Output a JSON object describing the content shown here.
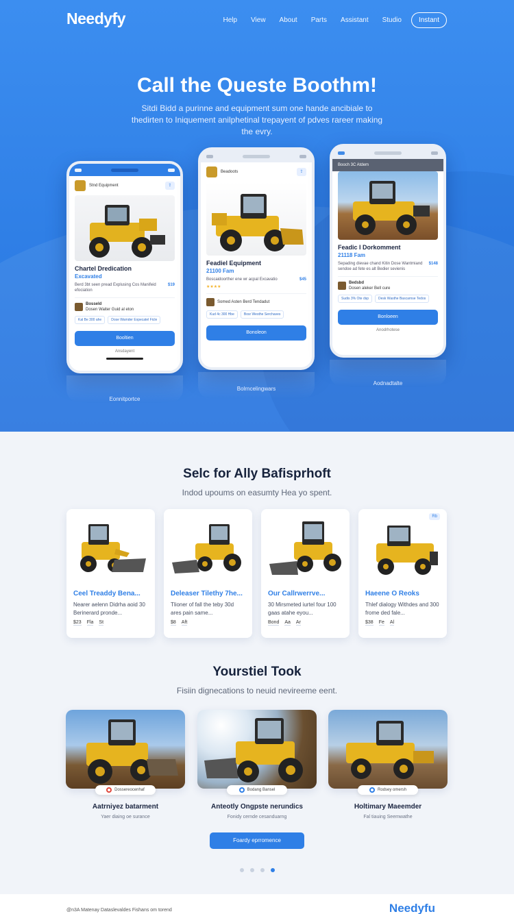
{
  "header": {
    "logo": "Needyfy",
    "nav": [
      "Help",
      "View",
      "About",
      "Parts",
      "Assistant",
      "Studio"
    ],
    "cta": "Instant"
  },
  "hero": {
    "title": "Call the Queste Boothm!",
    "subtitle": "Sitdi Bidd a purinne and equipment sum one hande ancibiale to thedirten to Iniquement anilphetinal trepayent of pdves rareer making the evry."
  },
  "phones": [
    {
      "header_text": "Stnd Equipment",
      "title": "Chartel Dredication",
      "price": "Excavated",
      "desc": "Berd 3bt seen pread Explusing Cos Manifeid efociation",
      "tag": "$19",
      "seller": "Bosseld",
      "seller_sub": "Dosen Waiter Guid al eton",
      "chip1": "Kal Be 300 ahe",
      "chip2": "Dose Wamder Expecatel Ficle",
      "button": "Booltien",
      "footer": "Ansdayent",
      "caption": "Eonnitportce"
    },
    {
      "header_text": "Beadoots",
      "title": "Feadiel Equipment",
      "price": "21100 Fam",
      "desc": "Boscaidoorther ene wr acpal Excavatio",
      "tag": "$45",
      "stars": "★★★★",
      "seller": "Somed Asten Berd Tendadut",
      "chip1": "Kud 4c 300 Hbe",
      "chip2": "Bosr Westhe Serchaves",
      "button": "Bonoleon",
      "caption": "Bolrncelingwars"
    },
    {
      "header_text": "Booch 3C Atdem",
      "title": "Feadic I Dorkomment",
      "price": "21118 Fam",
      "desc": "Sepading dievae chand Kitin Dose Wantmiand sendoe ad fete es alt Bedier sevienis",
      "tag": "$148",
      "seller": "Bedsbd",
      "seller_sub": "Dosen aleker Bell cure",
      "chip1": "Sudis 3% Ote dsp",
      "chip2": "Desk Wasthe Bascarnse Tedos",
      "button": "Bonloeen",
      "footer": "Anodrhotese",
      "caption": "Aodnadtalte"
    }
  ],
  "section2": {
    "title": "Selc for Ally Bafisprhoft",
    "subtitle": "Indod upoums on easumty Hea yo spent.",
    "cards": [
      {
        "title": "Ceel Treaddy Bena...",
        "desc": "Nearer aelenn Didrha aoid 30 Berinerard pronde...",
        "meta": [
          "$23",
          "Fla",
          "St"
        ],
        "badge": ""
      },
      {
        "title": "Deleaser Tilethy 7he...",
        "desc": "Tlioner of fall the teby 30d ares pain same...",
        "meta": [
          "$8",
          "Aft"
        ],
        "badge": ""
      },
      {
        "title": "Our Callrwerrve...",
        "desc": "30 Mirsmeted iurtel four 100 gaas atahe eyou...",
        "meta": [
          "Bond",
          "Aa",
          "Ar"
        ],
        "badge": ""
      },
      {
        "title": "Haeene O Reoks",
        "desc": "Thlef dialogy Withdes and 300 frome ded fale...",
        "meta": [
          "$38",
          "Fe",
          "Al"
        ],
        "badge": "Rb"
      }
    ]
  },
  "section3": {
    "title": "Yourstiel Took",
    "subtitle": "Fisiin dignecations to neuid nevireeme eent.",
    "cards": [
      {
        "pill": "Dossereocenhaf",
        "pill_color": "#e0463a",
        "title": "Aatrniyez batarment",
        "sub": "Yaer diaing oe surance"
      },
      {
        "pill": "Bodang Bansel",
        "pill_color": "#2f7fe6",
        "title": "Anteotly Ongpste nerundics",
        "sub": "Fonidy cernde cesanduarng"
      },
      {
        "pill": "Rodsey omersh",
        "pill_color": "#2f7fe6",
        "title": "Holtimary Maeemder",
        "sub": "Fal tiauing Seemwathe"
      }
    ],
    "cta": "Foardy eprromence"
  },
  "footer": {
    "text": "@n3A Matenay Dataslevaldes Fishans om torend",
    "logo": "Needyfu"
  },
  "colors": {
    "accent": "#2f7fe6",
    "hero_bg": "#3c8ef0",
    "page_bg": "#f1f4f9"
  }
}
